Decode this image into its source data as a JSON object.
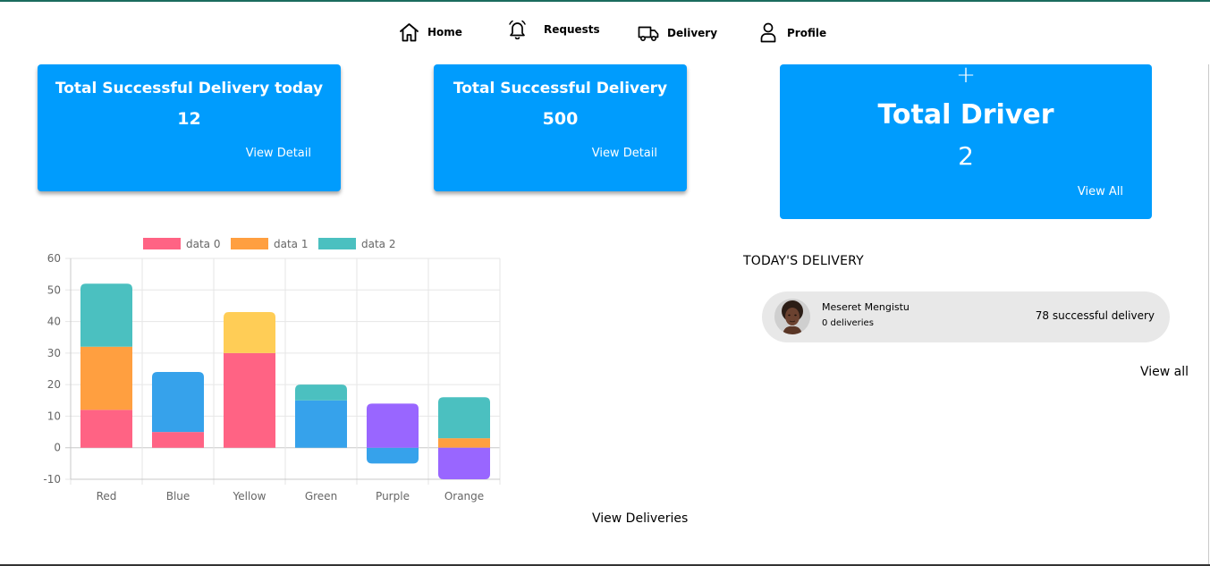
{
  "nav": {
    "items": [
      {
        "label": "Home",
        "icon": "home-icon"
      },
      {
        "label": "Requests",
        "icon": "bell-icon"
      },
      {
        "label": "Delivery",
        "icon": "truck-icon"
      },
      {
        "label": "Profile",
        "icon": "user-icon"
      }
    ]
  },
  "cards": [
    {
      "title": "Total Successful Delivery today",
      "value": "12",
      "link": "View Detail"
    },
    {
      "title": "Total Successful Delivery",
      "value": "500",
      "link": "View Detail"
    },
    {
      "icon": "+",
      "title": "Total Driver",
      "value": "2",
      "link": "View All"
    }
  ],
  "colors": {
    "accent": "#009cfd",
    "pill": "#e8e8e8"
  },
  "chart_data": {
    "type": "bar",
    "stacked": true,
    "categories": [
      "Red",
      "Blue",
      "Yellow",
      "Green",
      "Purple",
      "Orange"
    ],
    "ylim": [
      -10,
      60
    ],
    "yticks": [
      60,
      50,
      40,
      30,
      20,
      10,
      0,
      -10
    ],
    "legend_position": "top",
    "grid": true,
    "series": [
      {
        "name": "data 0",
        "color": "#ff6384",
        "values": [
          12,
          5,
          30,
          0,
          0,
          0
        ],
        "bar_colors": [
          "#ff6384",
          "#ff6384",
          "#ff6384",
          "#ff6384",
          "#ff6384",
          "#ff6384"
        ]
      },
      {
        "name": "data 1",
        "color": "#ff9f40",
        "values": [
          20,
          19,
          13,
          15,
          -5,
          3
        ],
        "bar_colors": [
          "#ff9f40",
          "#36a2eb",
          "#ffcd56",
          "#36a2eb",
          "#36a2eb",
          "#ff9f40"
        ]
      },
      {
        "name": "data 2",
        "color": "#4bc0c0",
        "values": [
          20,
          0,
          0,
          5,
          14,
          13
        ],
        "bar_colors": [
          "#4bc0c0",
          "#4bc0c0",
          "#4bc0c0",
          "#4bc0c0",
          "#9966ff",
          "#4bc0c0"
        ]
      },
      {
        "name": "",
        "color": "#9966ff",
        "values": [
          0,
          0,
          0,
          0,
          0,
          -10
        ],
        "bar_colors": [
          "#9966ff",
          "#9966ff",
          "#9966ff",
          "#9966ff",
          "#9966ff",
          "#9966ff"
        ]
      }
    ]
  },
  "view_deliveries": "View Deliveries",
  "today": {
    "title": "TODAY'S DELIVERY",
    "items": [
      {
        "name": "Meseret Mengistu",
        "count": "0 deliveries",
        "success": "78 successful delivery"
      }
    ],
    "view_all": "View all"
  }
}
